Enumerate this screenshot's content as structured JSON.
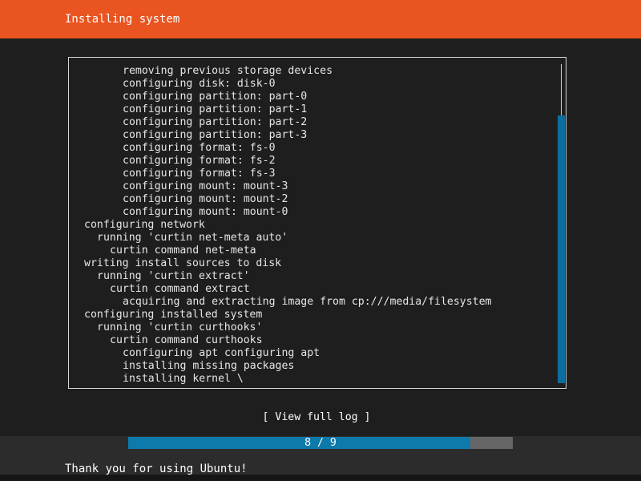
{
  "header": {
    "title": "Installing system",
    "color": "#e95420"
  },
  "log": {
    "lines": [
      {
        "indent": 4,
        "text": "removing previous storage devices"
      },
      {
        "indent": 4,
        "text": "configuring disk: disk-0"
      },
      {
        "indent": 4,
        "text": "configuring partition: part-0"
      },
      {
        "indent": 4,
        "text": "configuring partition: part-1"
      },
      {
        "indent": 4,
        "text": "configuring partition: part-2"
      },
      {
        "indent": 4,
        "text": "configuring partition: part-3"
      },
      {
        "indent": 4,
        "text": "configuring format: fs-0"
      },
      {
        "indent": 4,
        "text": "configuring format: fs-2"
      },
      {
        "indent": 4,
        "text": "configuring format: fs-3"
      },
      {
        "indent": 4,
        "text": "configuring mount: mount-3"
      },
      {
        "indent": 4,
        "text": "configuring mount: mount-2"
      },
      {
        "indent": 4,
        "text": "configuring mount: mount-0"
      },
      {
        "indent": 1,
        "text": "configuring network"
      },
      {
        "indent": 2,
        "text": "running 'curtin net-meta auto'"
      },
      {
        "indent": 3,
        "text": "curtin command net-meta"
      },
      {
        "indent": 1,
        "text": "writing install sources to disk"
      },
      {
        "indent": 2,
        "text": "running 'curtin extract'"
      },
      {
        "indent": 3,
        "text": "curtin command extract"
      },
      {
        "indent": 4,
        "text": "acquiring and extracting image from cp:///media/filesystem"
      },
      {
        "indent": 1,
        "text": "configuring installed system"
      },
      {
        "indent": 2,
        "text": "running 'curtin curthooks'"
      },
      {
        "indent": 3,
        "text": "curtin command curthooks"
      },
      {
        "indent": 4,
        "text": "configuring apt configuring apt"
      },
      {
        "indent": 4,
        "text": "installing missing packages"
      },
      {
        "indent": 4,
        "text": "installing kernel \\"
      }
    ],
    "scroll_position": 0.16,
    "scroll_visible_fraction": 0.84
  },
  "actions": {
    "view_full_log_label": "[ View full log ]"
  },
  "progress": {
    "current": 8,
    "total": 9,
    "label": "8 / 9",
    "fill_color": "#0e7aab",
    "track_color": "#666666"
  },
  "footer": {
    "message": "Thank you for using Ubuntu!"
  }
}
